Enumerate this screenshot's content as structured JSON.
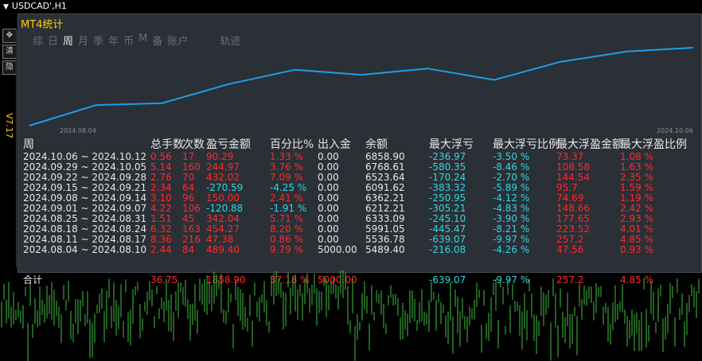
{
  "window": {
    "symbol_title": "USDCAD',H1"
  },
  "panel": {
    "title": "MT4统计"
  },
  "tabs": [
    {
      "label": "综",
      "active": false
    },
    {
      "label": "日",
      "active": false
    },
    {
      "label": "周",
      "active": true
    },
    {
      "label": "月",
      "active": false
    },
    {
      "label": "季",
      "active": false
    },
    {
      "label": "年",
      "active": false
    },
    {
      "label": "币",
      "active": false
    },
    {
      "label": "M",
      "active": false
    },
    {
      "label": "备",
      "active": false
    },
    {
      "label": "账户",
      "active": false
    },
    {
      "label": "轨迹",
      "active": false
    }
  ],
  "chart": {
    "x_start_label": "2024.08.04",
    "x_end_label": "2024.10.06",
    "line_color": "#1e9ee6",
    "balance_series": [
      5000.0,
      5489.4,
      5536.78,
      5991.05,
      6333.09,
      6212.21,
      6362.21,
      6091.62,
      6523.64,
      6768.61,
      6858.9
    ]
  },
  "table": {
    "headers": [
      "周",
      "总手数",
      "次数",
      "盈亏金额",
      "百分比%",
      "出入金",
      "余额",
      "最大浮亏",
      "最大浮亏比例",
      "最大浮盈金额",
      "最大浮盈比例"
    ],
    "rows": [
      [
        "2024.10.06 ~ 2024.10.12",
        "0.56",
        "17",
        "90.29",
        "1.33 %",
        "0.00",
        "6858.90",
        "-236.97",
        "-3.50 %",
        "73.37",
        "1.08 %"
      ],
      [
        "2024.09.29 ~ 2024.10.05",
        "5.14",
        "160",
        "244.97",
        "3.76 %",
        "0.00",
        "6768.61",
        "-580.35",
        "-8.46 %",
        "108.58",
        "1.63 %"
      ],
      [
        "2024.09.22 ~ 2024.09.28",
        "2.76",
        "70",
        "432.02",
        "7.09 %",
        "0.00",
        "6523.64",
        "-170.24",
        "-2.70 %",
        "144.54",
        "2.35 %"
      ],
      [
        "2024.09.15 ~ 2024.09.21",
        "2.34",
        "64",
        "-270.59",
        "-4.25 %",
        "0.00",
        "6091.62",
        "-383.32",
        "-5.89 %",
        "95.7",
        "1.59 %"
      ],
      [
        "2024.09.08 ~ 2024.09.14",
        "3.10",
        "96",
        "150.00",
        "2.41 %",
        "0.00",
        "6362.21",
        "-250.95",
        "-4.12 %",
        "74.69",
        "1.19 %"
      ],
      [
        "2024.09.01 ~ 2024.09.07",
        "4.22",
        "106",
        "-120.88",
        "-1.91 %",
        "0.00",
        "6212.21",
        "-305.21",
        "-4.83 %",
        "148.66",
        "2.42 %"
      ],
      [
        "2024.08.25 ~ 2024.08.31",
        "1.51",
        "45",
        "342.04",
        "5.71 %",
        "0.00",
        "6333.09",
        "-245.10",
        "-3.90 %",
        "177.65",
        "2.93 %"
      ],
      [
        "2024.08.18 ~ 2024.08.24",
        "6.32",
        "163",
        "454.27",
        "8.20 %",
        "0.00",
        "5991.05",
        "-445.47",
        "-8.21 %",
        "223.52",
        "4.01 %"
      ],
      [
        "2024.08.11 ~ 2024.08.17",
        "8.36",
        "216",
        "47.38",
        "0.86 %",
        "0.00",
        "5536.78",
        "-639.07",
        "-9.97 %",
        "257.2",
        "4.85 %"
      ],
      [
        "2024.08.04 ~ 2024.08.10",
        "2.44",
        "84",
        "489.40",
        "9.79 %",
        "5000.00",
        "5489.40",
        "-216.08",
        "-4.26 %",
        "47.56",
        "0.93 %"
      ]
    ],
    "total": [
      "合计",
      "36.75",
      "",
      "1858.90",
      "37.18 %",
      "5000.00",
      "",
      "-639.07",
      "-9.97 %",
      "257.2",
      "4.85 %"
    ]
  },
  "side_label": "V7.17",
  "colors": {
    "positive": "#ff2a2a",
    "negative": "#2ed7e6",
    "title": "#ffcc00",
    "candle": "#3fbf3f"
  }
}
